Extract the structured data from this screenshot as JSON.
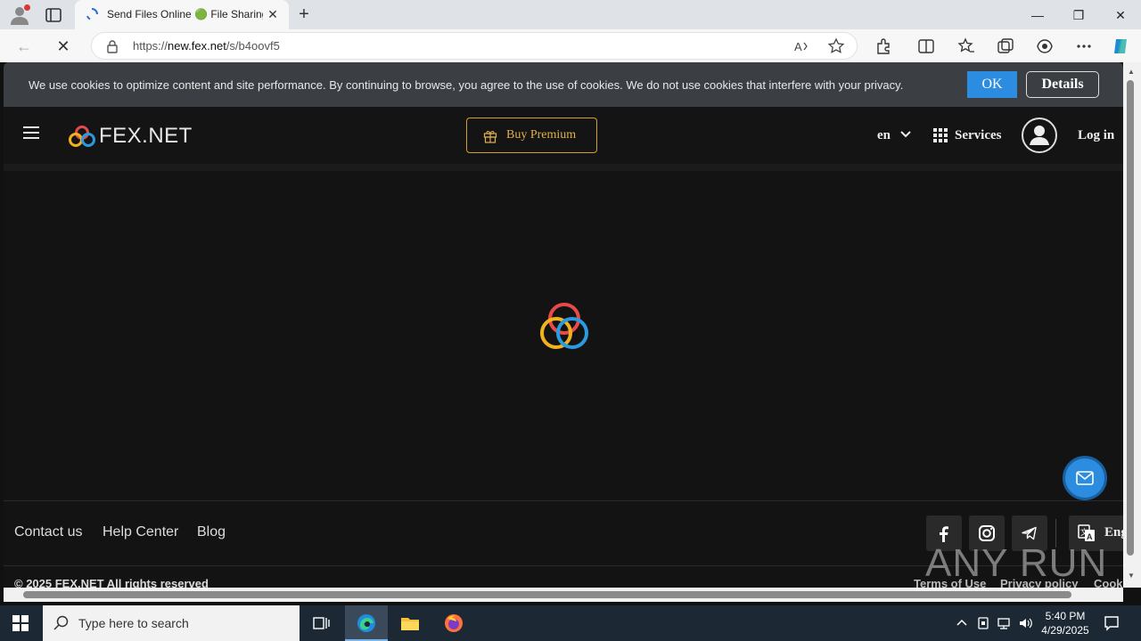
{
  "browser": {
    "tab_title": "Send Files Online 🟢 File Sharing",
    "url_prefix": "https://",
    "url_host": "new.fex.net",
    "url_path": "/s/b4oovf5"
  },
  "cookie_banner": {
    "message": "We use cookies to optimize content and site performance. By continuing to browse, you agree to the use of cookies. We do not use cookies that interfere with your privacy.",
    "ok_label": "OK",
    "details_label": "Details"
  },
  "header": {
    "logo_text": "FEX.NET",
    "premium_label": "Buy Premium",
    "language": "en",
    "services_label": "Services",
    "login_label": "Log in"
  },
  "footer": {
    "links": [
      "Contact us",
      "Help Center",
      "Blog"
    ],
    "translate_label": "Eng",
    "copyright": "© 2025 FEX.NET All rights reserved",
    "legal": [
      "Terms of Use",
      "Privacy policy",
      "Cooki"
    ]
  },
  "watermark": "ANY RUN",
  "taskbar": {
    "search_placeholder": "Type here to search",
    "time": "5:40 PM",
    "date": "4/29/2025"
  },
  "colors": {
    "accent_blue": "#2c8ce0",
    "premium_gold": "#d6a02a",
    "page_bg": "#131313"
  }
}
